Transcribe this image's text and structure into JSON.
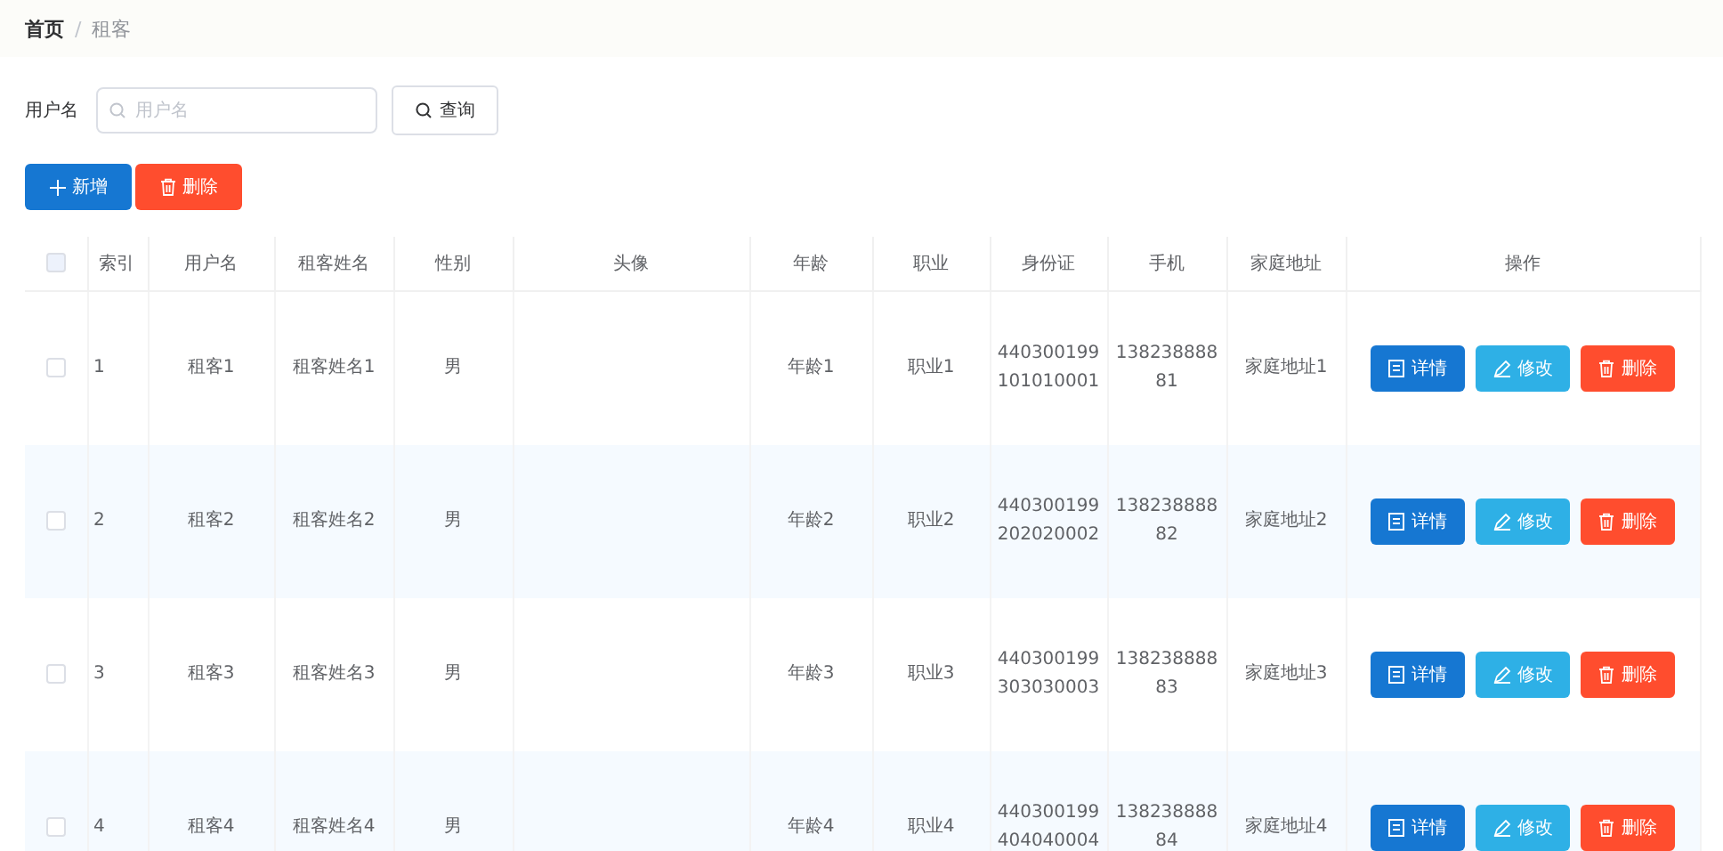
{
  "breadcrumb": [
    {
      "label": "首页",
      "selected": false
    },
    {
      "label": "租客",
      "selected": true
    }
  ],
  "breadcrumb_separator": "/",
  "search": {
    "label": "用户名",
    "placeholder": "用户名",
    "button": "查询"
  },
  "actions": [
    {
      "label": "新增",
      "kind": "add"
    },
    {
      "label": "删除",
      "kind": "delete"
    }
  ],
  "table": {
    "select_all_checked": false,
    "columns": [
      "索引",
      "用户名",
      "租客姓名",
      "性别",
      "头像",
      "年龄",
      "职业",
      "身份证",
      "手机",
      "家庭地址",
      "操作"
    ],
    "rows": [
      {
        "checked": false,
        "cells": [
          "1",
          "租客1",
          "租客姓名1",
          "男",
          "",
          "年龄1",
          "职业1",
          "440300199101010001",
          "13823888881",
          "家庭地址1"
        ],
        "actions": [
          {
            "label": "详情",
            "kind": "detail"
          },
          {
            "label": "修改",
            "kind": "edit"
          },
          {
            "label": "删除",
            "kind": "delete"
          }
        ]
      },
      {
        "checked": false,
        "cells": [
          "2",
          "租客2",
          "租客姓名2",
          "男",
          "",
          "年龄2",
          "职业2",
          "440300199202020002",
          "13823888882",
          "家庭地址2"
        ],
        "actions": [
          {
            "label": "详情",
            "kind": "detail"
          },
          {
            "label": "修改",
            "kind": "edit"
          },
          {
            "label": "删除",
            "kind": "delete"
          }
        ]
      },
      {
        "checked": false,
        "cells": [
          "3",
          "租客3",
          "租客姓名3",
          "男",
          "",
          "年龄3",
          "职业3",
          "440300199303030003",
          "13823888883",
          "家庭地址3"
        ],
        "actions": [
          {
            "label": "详情",
            "kind": "detail"
          },
          {
            "label": "修改",
            "kind": "edit"
          },
          {
            "label": "删除",
            "kind": "delete"
          }
        ]
      },
      {
        "checked": false,
        "cells": [
          "4",
          "租客4",
          "租客姓名4",
          "男",
          "",
          "年龄4",
          "职业4",
          "440300199404040004",
          "13823888884",
          "家庭地址4"
        ],
        "actions": [
          {
            "label": "详情",
            "kind": "detail"
          },
          {
            "label": "修改",
            "kind": "edit"
          },
          {
            "label": "删除",
            "kind": "delete"
          }
        ]
      }
    ]
  }
}
